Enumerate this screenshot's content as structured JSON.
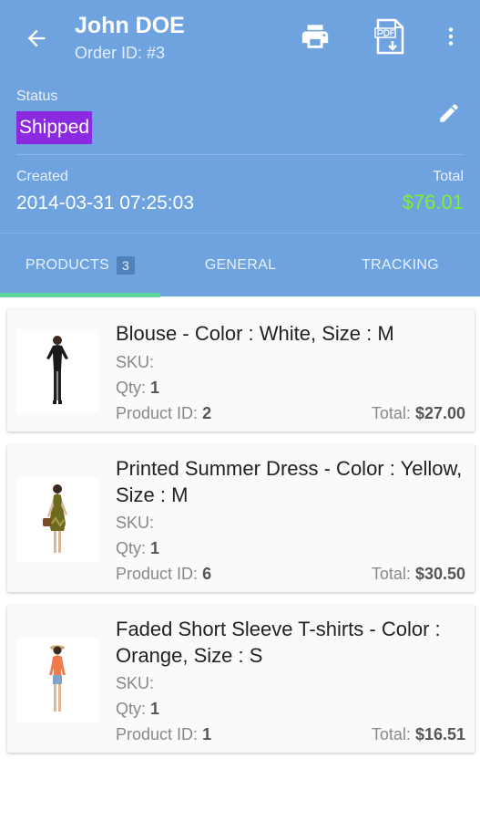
{
  "header": {
    "customer_name": "John DOE",
    "order_id": "Order ID: #3",
    "status_label": "Status",
    "status": "Shipped",
    "created_label": "Created",
    "created_value": "2014-03-31 07:25:03",
    "total_label": "Total",
    "total_value": "$76.01"
  },
  "icons": {
    "back": "arrow-back-icon",
    "print": "print-icon",
    "pdf": "pdf-download-icon",
    "more": "more-vert-icon",
    "edit": "pencil-icon"
  },
  "colors": {
    "header_bg": "#6fa3e0",
    "status_badge": "#8a2be2",
    "total_green": "#7cf032",
    "tab_indicator": "#5ed6a0"
  },
  "tabs": [
    {
      "label": "PRODUCTS",
      "count": "3",
      "active": true
    },
    {
      "label": "GENERAL",
      "active": false
    },
    {
      "label": "TRACKING",
      "active": false
    }
  ],
  "products": [
    {
      "name": "Blouse - Color : White, Size : M",
      "sku_label": "SKU:",
      "sku": "",
      "qty_label": "Qty:",
      "qty": "1",
      "pid_label": "Product ID:",
      "product_id": "2",
      "total_label": "Total:",
      "total": "$27.00"
    },
    {
      "name": "Printed Summer Dress - Color : Yellow, Size : M",
      "sku_label": "SKU:",
      "sku": "",
      "qty_label": "Qty:",
      "qty": "1",
      "pid_label": "Product ID:",
      "product_id": "6",
      "total_label": "Total:",
      "total": "$30.50"
    },
    {
      "name": "Faded Short Sleeve T-shirts - Color : Orange, Size : S",
      "sku_label": "SKU:",
      "sku": "",
      "qty_label": "Qty:",
      "qty": "1",
      "pid_label": "Product ID:",
      "product_id": "1",
      "total_label": "Total:",
      "total": "$16.51"
    }
  ]
}
